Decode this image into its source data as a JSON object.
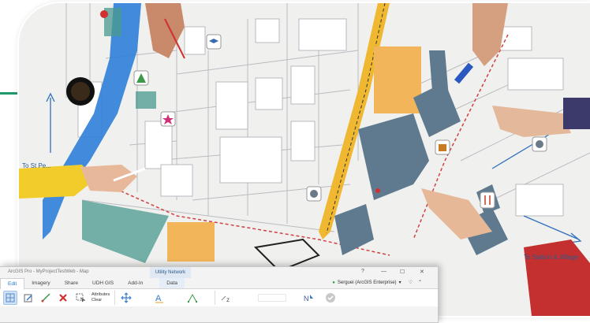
{
  "map": {
    "caption_left": "To St Pe...",
    "caption_right": "To Station & Village"
  },
  "app": {
    "title": "ArcGIS Pro - MyProjectTestWeb - Map",
    "context_tab_group": "Utility Network",
    "help": "?",
    "minimize": "—",
    "maximize": "☐",
    "close": "✕",
    "tabs": [
      "Edit",
      "Imagery",
      "Share",
      "UDH GIS",
      "Add-In",
      "Data"
    ],
    "user": "Serguei (ArcGIS Enterprise)",
    "toolbar": {
      "attributes_label": "Attributes",
      "clear_label": "Clear"
    }
  },
  "colors": {
    "accent": "#2a73c5",
    "river": "#2f7fd9",
    "road": "#f0b730",
    "building_dark": "#5f7a8f",
    "park": "#f2b55a"
  }
}
